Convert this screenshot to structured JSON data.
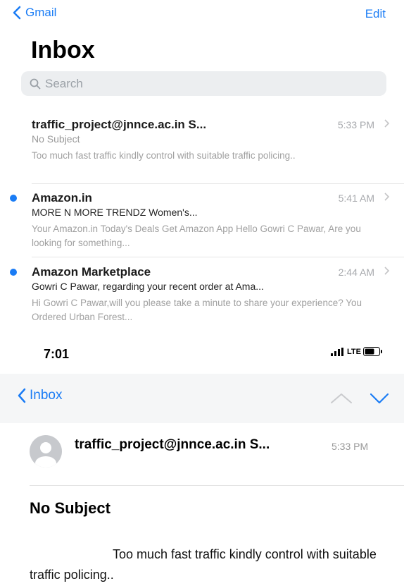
{
  "top_nav": {
    "back_label": "Gmail",
    "edit_label": "Edit"
  },
  "page": {
    "title": "Inbox"
  },
  "search": {
    "placeholder": "Search"
  },
  "emails": [
    {
      "from": "traffic_project@jnnce.ac.in S...",
      "time": "5:33 PM",
      "subject": "No Subject",
      "preview": "Too much fast traffic kindly control with suitable traffic policing..",
      "unread": false
    },
    {
      "from": "Amazon.in",
      "time": "5:41 AM",
      "subject": "MORE N MORE TRENDZ Women's...",
      "preview": "Your Amazon.in Today's Deals Get Amazon App Hello Gowri C Pawar, Are you looking for something...",
      "unread": true
    },
    {
      "from": "Amazon Marketplace",
      "time": "2:44 AM",
      "subject": "Gowri C Pawar, regarding your recent order at Ama...",
      "preview": "Hi Gowri C Pawar,will you please take a minute to share your experience? You Ordered Urban Forest...",
      "unread": true
    }
  ],
  "status_bar": {
    "time": "7:01",
    "network": "LTE"
  },
  "detail_nav": {
    "back_label": "Inbox"
  },
  "detail": {
    "from": "traffic_project@jnnce.ac.in S...",
    "time": "5:33 PM",
    "subject": "No Subject",
    "body": "Too much fast traffic kindly control with suitable traffic policing.."
  },
  "colors": {
    "accent": "#1a7cf5",
    "unread_dot": "#1a7cf5"
  },
  "icons": [
    "chevron-left-icon",
    "search-icon",
    "chevron-right-icon",
    "signal-icon",
    "battery-icon",
    "chevron-up-icon",
    "chevron-down-icon",
    "avatar-icon"
  ]
}
